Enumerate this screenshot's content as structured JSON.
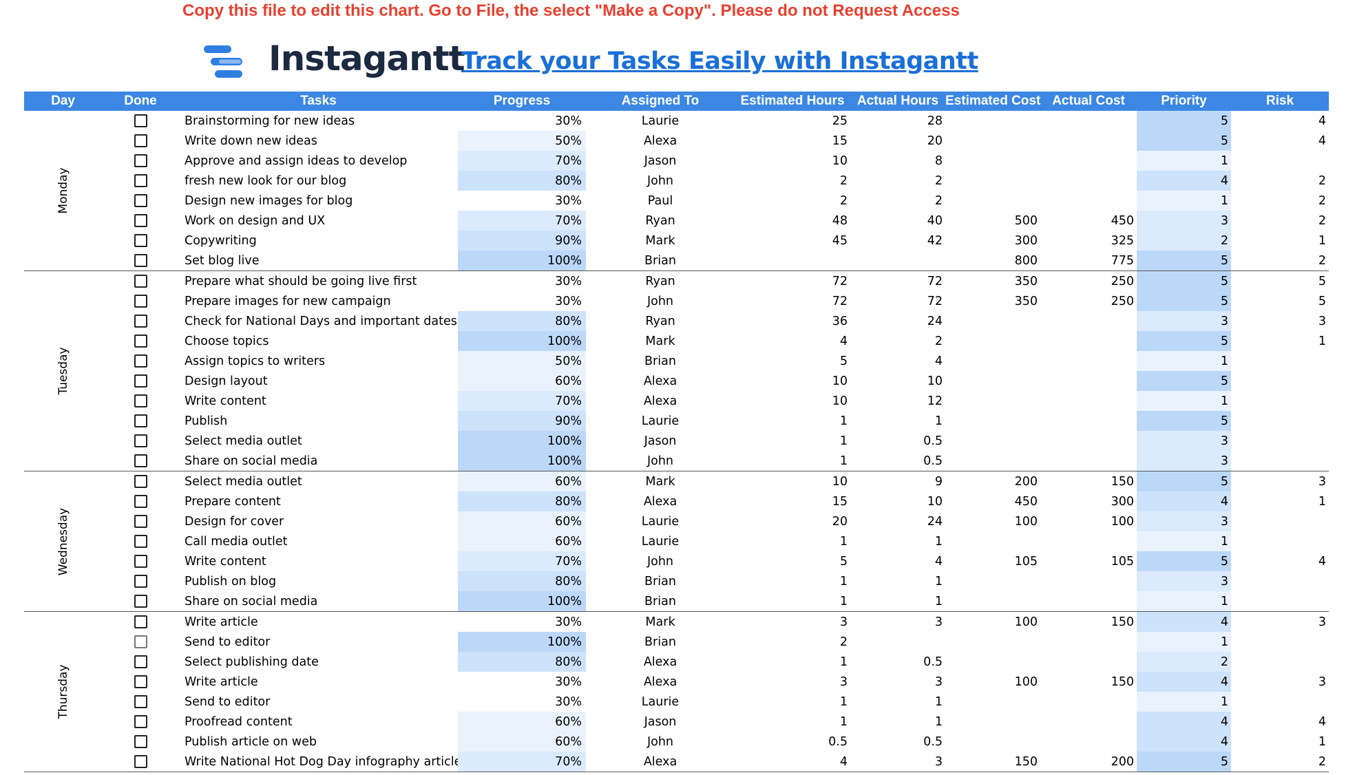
{
  "notice": "Copy this file to edit this chart. Go to File, the select \"Make a Copy\". Please do not Request Access",
  "brand": {
    "name": "Instagantt",
    "tagline": "Track your Tasks Easily with Instagantt"
  },
  "colors": {
    "header_bg": "#3b87e3",
    "notice": "#e8402e",
    "brand": "#1b2a41",
    "link": "#1a6fd8",
    "heat_levels": [
      "#ffffff",
      "#eaf3fd",
      "#dceafd",
      "#cde2fb",
      "#bcd8f9"
    ]
  },
  "icons": {
    "checkbox": "checkbox-icon",
    "logo": "instagantt-logo-icon"
  },
  "columns": [
    "Day",
    "Done",
    "Tasks",
    "Progress",
    "Assigned To",
    "Estimated Hours",
    "Actual Hours",
    "Estimated Cost",
    "Actual Cost",
    "Priority",
    "Risk"
  ],
  "groups": [
    {
      "day": "Monday",
      "rows": [
        {
          "task": "Brainstorming for new ideas",
          "progress": "30%",
          "assigned": "Laurie",
          "est_hours": "25",
          "act_hours": "28",
          "est_cost": "",
          "act_cost": "",
          "priority": "5",
          "risk": "4",
          "progress_shade": 0,
          "priority_shade": 4
        },
        {
          "task": "Write down new ideas",
          "progress": "50%",
          "assigned": "Alexa",
          "est_hours": "15",
          "act_hours": "20",
          "est_cost": "",
          "act_cost": "",
          "priority": "5",
          "risk": "4",
          "progress_shade": 1,
          "priority_shade": 4
        },
        {
          "task": "Approve and assign ideas to develop",
          "progress": "70%",
          "assigned": "Jason",
          "est_hours": "10",
          "act_hours": "8",
          "est_cost": "",
          "act_cost": "",
          "priority": "1",
          "risk": "",
          "progress_shade": 2,
          "priority_shade": 1
        },
        {
          "task": "fresh new look for our blog",
          "progress": "80%",
          "assigned": "John",
          "est_hours": "2",
          "act_hours": "2",
          "est_cost": "",
          "act_cost": "",
          "priority": "4",
          "risk": "2",
          "progress_shade": 3,
          "priority_shade": 3
        },
        {
          "task": "Design new images for blog",
          "progress": "30%",
          "assigned": "Paul",
          "est_hours": "2",
          "act_hours": "2",
          "est_cost": "",
          "act_cost": "",
          "priority": "1",
          "risk": "2",
          "progress_shade": 0,
          "priority_shade": 1
        },
        {
          "task": "Work on design and UX",
          "progress": "70%",
          "assigned": "Ryan",
          "est_hours": "48",
          "act_hours": "40",
          "est_cost": "500",
          "act_cost": "450",
          "priority": "3",
          "risk": "2",
          "progress_shade": 2,
          "priority_shade": 2
        },
        {
          "task": "Copywriting",
          "progress": "90%",
          "assigned": "Mark",
          "est_hours": "45",
          "act_hours": "42",
          "est_cost": "300",
          "act_cost": "325",
          "priority": "2",
          "risk": "1",
          "progress_shade": 3,
          "priority_shade": 2
        },
        {
          "task": "Set blog live",
          "progress": "100%",
          "assigned": "Brian",
          "est_hours": "",
          "act_hours": "",
          "est_cost": "800",
          "act_cost": "775",
          "priority": "5",
          "risk": "2",
          "progress_shade": 4,
          "priority_shade": 4
        }
      ]
    },
    {
      "day": "Tuesday",
      "rows": [
        {
          "task": "Prepare what should be going live first",
          "progress": "30%",
          "assigned": "Ryan",
          "est_hours": "72",
          "act_hours": "72",
          "est_cost": "350",
          "act_cost": "250",
          "priority": "5",
          "risk": "5",
          "progress_shade": 0,
          "priority_shade": 4
        },
        {
          "task": "Prepare images for new campaign",
          "progress": "30%",
          "assigned": "John",
          "est_hours": "72",
          "act_hours": "72",
          "est_cost": "350",
          "act_cost": "250",
          "priority": "5",
          "risk": "5",
          "progress_shade": 0,
          "priority_shade": 4
        },
        {
          "task": "Check for National Days and important dates",
          "progress": "80%",
          "assigned": "Ryan",
          "est_hours": "36",
          "act_hours": "24",
          "est_cost": "",
          "act_cost": "",
          "priority": "3",
          "risk": "3",
          "progress_shade": 3,
          "priority_shade": 2
        },
        {
          "task": "Choose topics",
          "progress": "100%",
          "assigned": "Mark",
          "est_hours": "4",
          "act_hours": "2",
          "est_cost": "",
          "act_cost": "",
          "priority": "5",
          "risk": "1",
          "progress_shade": 4,
          "priority_shade": 4
        },
        {
          "task": "Assign topics to writers",
          "progress": "50%",
          "assigned": "Brian",
          "est_hours": "5",
          "act_hours": "4",
          "est_cost": "",
          "act_cost": "",
          "priority": "1",
          "risk": "",
          "progress_shade": 1,
          "priority_shade": 1
        },
        {
          "task": "Design layout",
          "progress": "60%",
          "assigned": "Alexa",
          "est_hours": "10",
          "act_hours": "10",
          "est_cost": "",
          "act_cost": "",
          "priority": "5",
          "risk": "",
          "progress_shade": 1,
          "priority_shade": 4
        },
        {
          "task": "Write content",
          "progress": "70%",
          "assigned": "Alexa",
          "est_hours": "10",
          "act_hours": "12",
          "est_cost": "",
          "act_cost": "",
          "priority": "1",
          "risk": "",
          "progress_shade": 2,
          "priority_shade": 1
        },
        {
          "task": "Publish",
          "progress": "90%",
          "assigned": "Laurie",
          "est_hours": "1",
          "act_hours": "1",
          "est_cost": "",
          "act_cost": "",
          "priority": "5",
          "risk": "",
          "progress_shade": 3,
          "priority_shade": 4
        },
        {
          "task": "Select media outlet",
          "progress": "100%",
          "assigned": "Jason",
          "est_hours": "1",
          "act_hours": "0.5",
          "est_cost": "",
          "act_cost": "",
          "priority": "3",
          "risk": "",
          "progress_shade": 4,
          "priority_shade": 2
        },
        {
          "task": "Share on social media",
          "progress": "100%",
          "assigned": "John",
          "est_hours": "1",
          "act_hours": "0.5",
          "est_cost": "",
          "act_cost": "",
          "priority": "3",
          "risk": "",
          "progress_shade": 4,
          "priority_shade": 2
        }
      ]
    },
    {
      "day": "Wednesday",
      "rows": [
        {
          "task": "Select media outlet",
          "progress": "60%",
          "assigned": "Mark",
          "est_hours": "10",
          "act_hours": "9",
          "est_cost": "200",
          "act_cost": "150",
          "priority": "5",
          "risk": "3",
          "progress_shade": 1,
          "priority_shade": 4
        },
        {
          "task": "Prepare content",
          "progress": "80%",
          "assigned": "Alexa",
          "est_hours": "15",
          "act_hours": "10",
          "est_cost": "450",
          "act_cost": "300",
          "priority": "4",
          "risk": "1",
          "progress_shade": 3,
          "priority_shade": 3
        },
        {
          "task": "Design for cover",
          "progress": "60%",
          "assigned": "Laurie",
          "est_hours": "20",
          "act_hours": "24",
          "est_cost": "100",
          "act_cost": "100",
          "priority": "3",
          "risk": "",
          "progress_shade": 1,
          "priority_shade": 2
        },
        {
          "task": "Call media outlet",
          "progress": "60%",
          "assigned": "Laurie",
          "est_hours": "1",
          "act_hours": "1",
          "est_cost": "",
          "act_cost": "",
          "priority": "1",
          "risk": "",
          "progress_shade": 1,
          "priority_shade": 1
        },
        {
          "task": "Write content",
          "progress": "70%",
          "assigned": "John",
          "est_hours": "5",
          "act_hours": "4",
          "est_cost": "105",
          "act_cost": "105",
          "priority": "5",
          "risk": "4",
          "progress_shade": 2,
          "priority_shade": 4
        },
        {
          "task": "Publish on blog",
          "progress": "80%",
          "assigned": "Brian",
          "est_hours": "1",
          "act_hours": "1",
          "est_cost": "",
          "act_cost": "",
          "priority": "3",
          "risk": "",
          "progress_shade": 3,
          "priority_shade": 2
        },
        {
          "task": "Share on social media",
          "progress": "100%",
          "assigned": "Brian",
          "est_hours": "1",
          "act_hours": "1",
          "est_cost": "",
          "act_cost": "",
          "priority": "1",
          "risk": "",
          "progress_shade": 4,
          "priority_shade": 1
        }
      ]
    },
    {
      "day": "Thursday",
      "rows": [
        {
          "task": "Write article",
          "progress": "30%",
          "assigned": "Mark",
          "est_hours": "3",
          "act_hours": "3",
          "est_cost": "100",
          "act_cost": "150",
          "priority": "4",
          "risk": "3",
          "progress_shade": 0,
          "priority_shade": 3
        },
        {
          "task": "Send to editor",
          "progress": "100%",
          "assigned": "Brian",
          "est_hours": "2",
          "act_hours": "",
          "est_cost": "",
          "act_cost": "",
          "priority": "1",
          "risk": "",
          "progress_shade": 4,
          "priority_shade": 1,
          "checkbox_light": true
        },
        {
          "task": "Select publishing date",
          "progress": "80%",
          "assigned": "Alexa",
          "est_hours": "1",
          "act_hours": "0.5",
          "est_cost": "",
          "act_cost": "",
          "priority": "2",
          "risk": "",
          "progress_shade": 3,
          "priority_shade": 2
        },
        {
          "task": "Write article",
          "progress": "30%",
          "assigned": "Alexa",
          "est_hours": "3",
          "act_hours": "3",
          "est_cost": "100",
          "act_cost": "150",
          "priority": "4",
          "risk": "3",
          "progress_shade": 0,
          "priority_shade": 3
        },
        {
          "task": "Send to editor",
          "progress": "30%",
          "assigned": "Laurie",
          "est_hours": "1",
          "act_hours": "1",
          "est_cost": "",
          "act_cost": "",
          "priority": "1",
          "risk": "",
          "progress_shade": 0,
          "priority_shade": 1
        },
        {
          "task": "Proofread content",
          "progress": "60%",
          "assigned": "Jason",
          "est_hours": "1",
          "act_hours": "1",
          "est_cost": "",
          "act_cost": "",
          "priority": "4",
          "risk": "4",
          "progress_shade": 1,
          "priority_shade": 3
        },
        {
          "task": "Publish article on web",
          "progress": "60%",
          "assigned": "John",
          "est_hours": "0.5",
          "act_hours": "0.5",
          "est_cost": "",
          "act_cost": "",
          "priority": "4",
          "risk": "1",
          "progress_shade": 1,
          "priority_shade": 3
        },
        {
          "task": "Write National Hot Dog Day infography article",
          "progress": "70%",
          "assigned": "Alexa",
          "est_hours": "4",
          "act_hours": "3",
          "est_cost": "150",
          "act_cost": "200",
          "priority": "5",
          "risk": "2",
          "progress_shade": 2,
          "priority_shade": 4
        }
      ]
    }
  ]
}
